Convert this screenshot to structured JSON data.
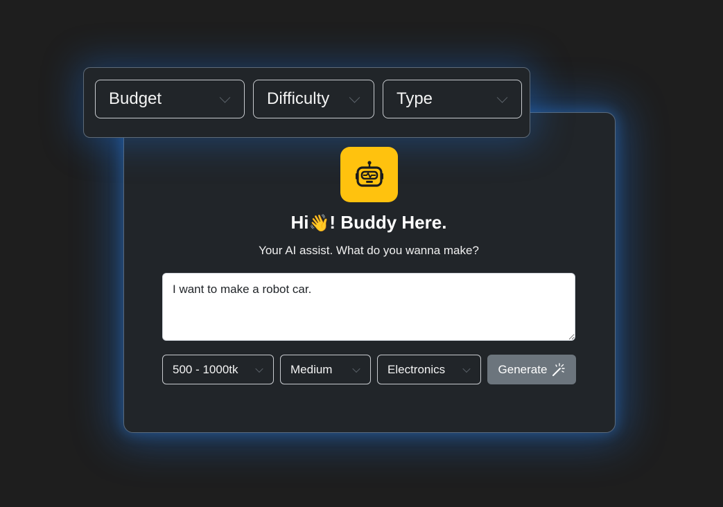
{
  "filters_top": {
    "budget_label": "Budget",
    "difficulty_label": "Difficulty",
    "type_label": "Type"
  },
  "assistant": {
    "icon": "robot-icon",
    "accent_color": "#ffc20e",
    "title_pre": "Hi",
    "title_emoji": "👋",
    "title_post": "! Buddy Here.",
    "subtitle": "Your AI assist. What do you wanna make?"
  },
  "prompt": {
    "value": "I want to make a robot car."
  },
  "filters": {
    "budget_value": "500 - 1000tk",
    "difficulty_value": "Medium",
    "type_value": "Electronics"
  },
  "generate": {
    "label": "Generate",
    "icon": "magic-wand-icon",
    "color": "#6c757d"
  }
}
